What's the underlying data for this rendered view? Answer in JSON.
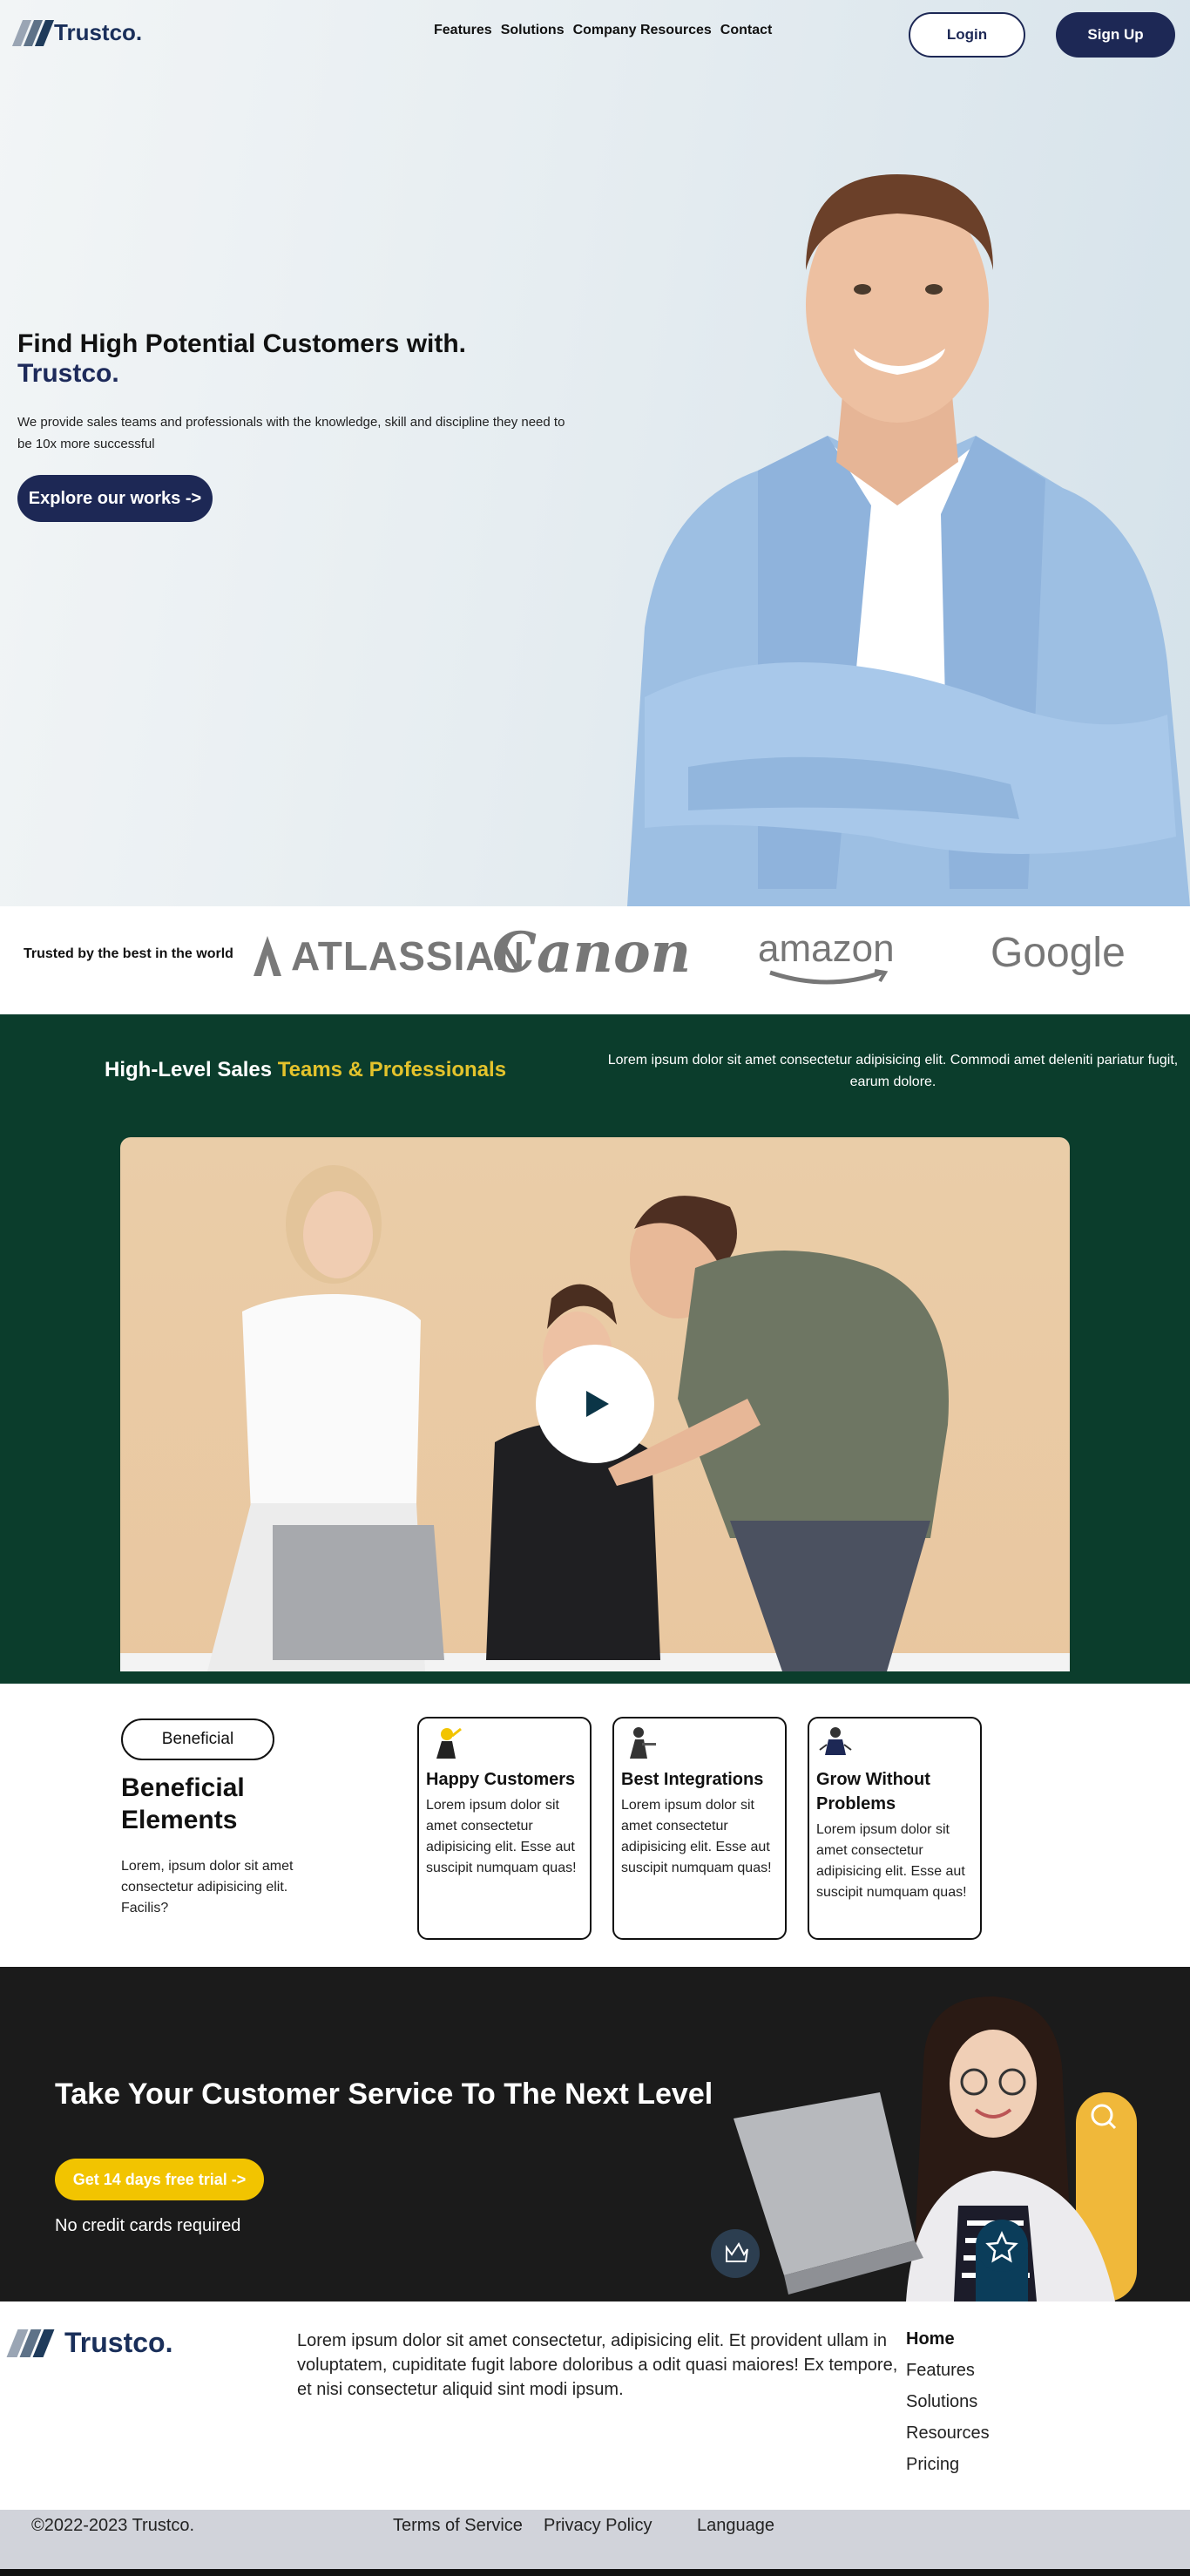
{
  "header": {
    "brand": "Trustco.",
    "nav": [
      "Features",
      "Solutions",
      "Company Resources",
      "Contact"
    ],
    "login_label": "Login",
    "signup_label": "Sign Up"
  },
  "hero": {
    "title": "Find High Potential Customers with.",
    "brand": "Trustco.",
    "description": "We provide sales teams and professionals with the knowledge, skill and discipline they need to be 10x more successful",
    "cta_label": "Explore our works ->"
  },
  "trusted": {
    "label": "Trusted by the best in the world",
    "brands": [
      "ATLASSIAN",
      "Canon",
      "amazon",
      "Google"
    ]
  },
  "sales": {
    "title_plain": "High-Level Sales",
    "title_accent": "Teams & Professionals",
    "description": "Lorem ipsum dolor sit amet consectetur adipisicing elit. Commodi amet deleniti pariatur fugit, earum dolore."
  },
  "beneficial": {
    "pill": "Beneficial",
    "title": "Beneficial Elements",
    "description": "Lorem, ipsum dolor sit amet consectetur adipisicing elit. Facilis?",
    "cards": [
      {
        "title": "Happy Customers",
        "text": "Lorem ipsum dolor sit amet consectetur adipisicing elit. Esse aut suscipit numquam quas!"
      },
      {
        "title": "Best Integrations",
        "text": "Lorem ipsum dolor sit amet consectetur adipisicing elit. Esse aut suscipit numquam quas!"
      },
      {
        "title": "Grow Without Problems",
        "text": "Lorem ipsum dolor sit amet consectetur adipisicing elit. Esse aut suscipit numquam quas!"
      }
    ]
  },
  "cta": {
    "title": "Take Your Customer Service To The Next Level",
    "button_label": "Get 14 days free trial ->",
    "note": "No credit cards required"
  },
  "footer": {
    "brand": "Trustco.",
    "description": "Lorem ipsum dolor sit amet consectetur, adipisicing elit. Et provident ullam in voluptatem, cupiditate fugit labore doloribus a odit quasi maiores! Ex tempore, et nisi consectetur aliquid sint modi ipsum.",
    "links": [
      "Home",
      "Features",
      "Solutions",
      "Resources",
      "Pricing"
    ],
    "copyright": "©2022-2023 Trustco.",
    "terms": "Terms of Service",
    "privacy": "Privacy Policy",
    "language": "Language"
  },
  "colors": {
    "navy": "#1d2855",
    "green": "#0b3d2c",
    "accent_yellow": "#e4c32c",
    "cta_yellow": "#f2c400",
    "dark": "#1b1b1b"
  }
}
